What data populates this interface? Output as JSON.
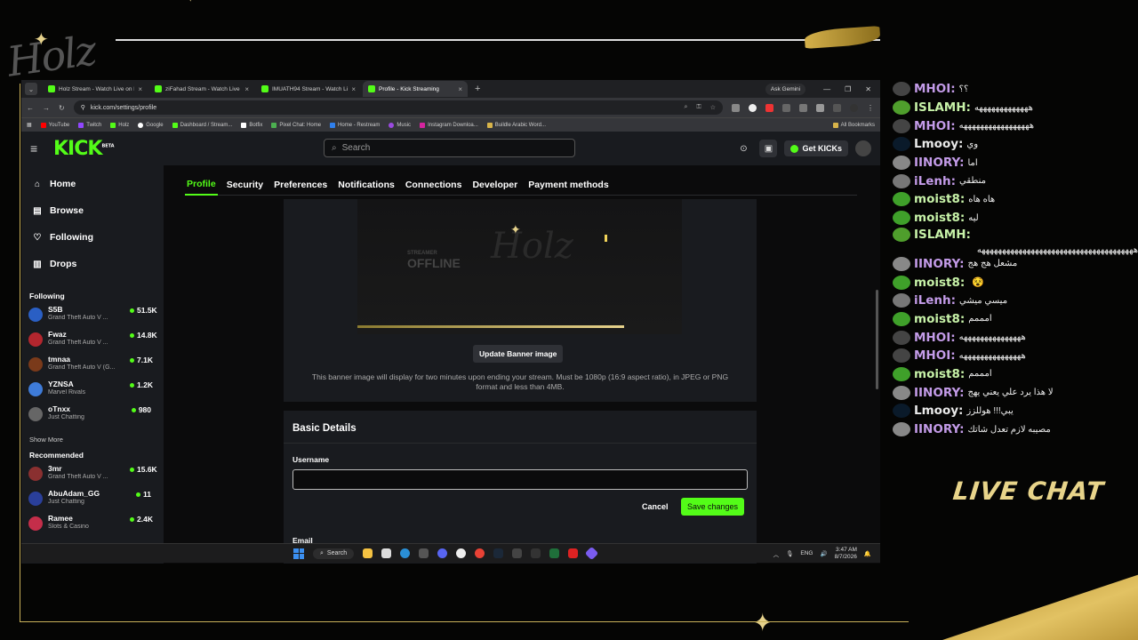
{
  "browser": {
    "tabs": [
      {
        "title": "Holz Stream - Watch Live on Ki",
        "active": false
      },
      {
        "title": "ziFahad Stream - Watch Live or",
        "active": false
      },
      {
        "title": "IMUATH94 Stream - Watch Live",
        "active": false
      },
      {
        "title": "Profile - Kick Streaming",
        "active": true
      }
    ],
    "ask": "Ask Gemini",
    "url": "kick.com/settings/profile",
    "bookmarks": [
      "YouTube",
      "Twitch",
      "Holz",
      "Google",
      "Dashboard / Stream...",
      "Botfix",
      "Pixel Chat: Home",
      "Home - Restream",
      "Music",
      "Instagram Downloa...",
      "Buildle Arabic Word..."
    ],
    "all_bookmarks": "All Bookmarks"
  },
  "kick": {
    "logo": "KICK",
    "logo_sup": "BETA",
    "search_placeholder": "Search",
    "get_kicks": "Get KICKs",
    "nav": [
      {
        "label": "Home",
        "icon": "home-icon"
      },
      {
        "label": "Browse",
        "icon": "browse-icon"
      },
      {
        "label": "Following",
        "icon": "heart-icon"
      },
      {
        "label": "Drops",
        "icon": "drops-icon"
      }
    ],
    "following_title": "Following",
    "following": [
      {
        "name": "S5B",
        "category": "Grand Theft Auto V ...",
        "viewers": "51.5K",
        "color": "#2a5fc4"
      },
      {
        "name": "Fwaz",
        "category": "Grand Theft Auto V ...",
        "viewers": "14.8K",
        "color": "#b3262e"
      },
      {
        "name": "tmnaa",
        "category": "Grand Theft Auto V (G...",
        "viewers": "7.1K",
        "color": "#7a3a1a"
      },
      {
        "name": "YZNSA",
        "category": "Marvel Rivals",
        "viewers": "1.2K",
        "color": "#3e7bd8"
      },
      {
        "name": "oTnxx",
        "category": "Just Chatting",
        "viewers": "980",
        "color": "#666"
      }
    ],
    "show_more": "Show More",
    "recommended_title": "Recommended",
    "recommended": [
      {
        "name": "3mr",
        "category": "Grand Theft Auto V ...",
        "viewers": "15.6K",
        "color": "#8a3030"
      },
      {
        "name": "AbuAdam_GG",
        "category": "Just Chatting",
        "viewers": "11",
        "color": "#2a3f9a"
      },
      {
        "name": "Ramee",
        "category": "Slots & Casino",
        "viewers": "2.4K",
        "color": "#c42e4a"
      }
    ],
    "subtabs": [
      "Profile",
      "Security",
      "Preferences",
      "Notifications",
      "Connections",
      "Developer",
      "Payment methods"
    ],
    "active_subtab": "Profile",
    "banner_offline": "OFFLINE",
    "banner_streamer": "STREAMER",
    "banner_logo": "Holz",
    "update_banner": "Update Banner image",
    "banner_note": "This banner image will display for two minutes upon ending your stream. Must be 1080p (16:9 aspect ratio), in JPEG or PNG format and less than 4MB.",
    "basic_details": "Basic Details",
    "username_label": "Username",
    "username_value": "",
    "cancel": "Cancel",
    "save": "Save changes",
    "email_label": "Email"
  },
  "taskbar": {
    "search": "Search",
    "lang": "ENG",
    "time": "3:47 AM",
    "date": "8/7/2026"
  },
  "overlay": {
    "logo_text": "Holz",
    "live_chat": "LIVE CHAT"
  },
  "chat": [
    {
      "name": "MHOI:",
      "text": "؟؟",
      "color": "#c39be8",
      "avatar": "#444"
    },
    {
      "name": "ISLAMH:",
      "text": "هههههههههههههه",
      "color": "#c7f2a8",
      "avatar": "#4f9e2c"
    },
    {
      "name": "MHOI:",
      "text": "هههههههههههههههههه",
      "color": "#c39be8",
      "avatar": "#444"
    },
    {
      "name": "Lmooy:",
      "text": "وي",
      "color": "#e9e9e9",
      "avatar": "#0a1a2a"
    },
    {
      "name": "IINORY:",
      "text": "اما",
      "color": "#c39be8",
      "avatar": "#888"
    },
    {
      "name": "iLenh:",
      "text": "منطقي",
      "color": "#c39be8",
      "avatar": "#777"
    },
    {
      "name": "moist8:",
      "text": "هاه هاه",
      "color": "#c7f2a8",
      "avatar": "#3fa02a"
    },
    {
      "name": "moist8:",
      "text": "ليه",
      "color": "#c7f2a8",
      "avatar": "#3fa02a"
    },
    {
      "name": "ISLAMH:",
      "text": "ههههههههههههههههههههههههههههههههههههههه",
      "color": "#c7f2a8",
      "avatar": "#4f9e2c",
      "wrap": true
    },
    {
      "name": "IINORY:",
      "text": "مشعل هج هج",
      "color": "#c39be8",
      "avatar": "#888"
    },
    {
      "name": "moist8:",
      "text": "",
      "color": "#c7f2a8",
      "avatar": "#3fa02a"
    },
    {
      "name": "iLenh:",
      "text": "ميسي ميشي",
      "color": "#c39be8",
      "avatar": "#777"
    },
    {
      "name": "moist8:",
      "text": "امممم",
      "color": "#c7f2a8",
      "avatar": "#3fa02a"
    },
    {
      "name": "MHOI:",
      "text": "هههههههههههههههه",
      "color": "#c39be8",
      "avatar": "#444"
    },
    {
      "name": "MHOI:",
      "text": "هههههههههههههههه",
      "color": "#c39be8",
      "avatar": "#444"
    },
    {
      "name": "moist8:",
      "text": "امممم",
      "color": "#c7f2a8",
      "avatar": "#3fa02a"
    },
    {
      "name": "IINORY:",
      "text": "لا هذا يرد علي يعني يهج",
      "color": "#c39be8",
      "avatar": "#888"
    },
    {
      "name": "Lmooy:",
      "text": "يبي!!! هوللزز",
      "color": "#e9e9e9",
      "avatar": "#0a1a2a"
    },
    {
      "name": "IINORY:",
      "text": "مصيبه لازم تعدل شاتك",
      "color": "#c39be8",
      "avatar": "#888"
    }
  ]
}
